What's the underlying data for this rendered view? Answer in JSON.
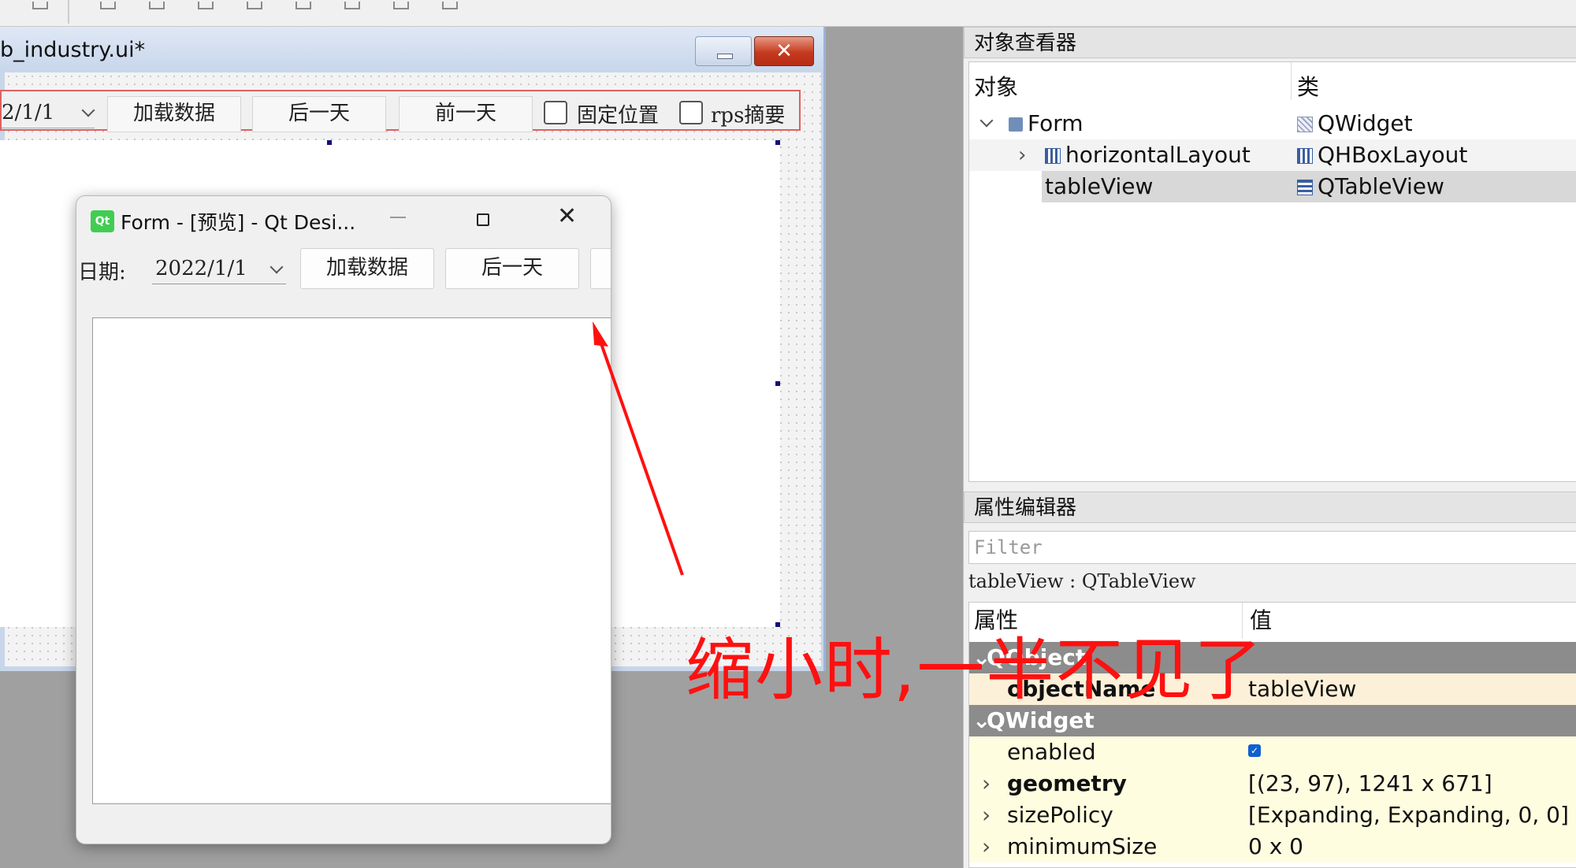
{
  "designer": {
    "title": "b_industry.ui*",
    "toolbar": {
      "date_value": "2/1/1",
      "load_button": "加载数据",
      "next_day_button": "后一天",
      "prev_day_button": "前一天",
      "fixed_position_label": "固定位置",
      "rps_summary_label": "rps摘要"
    }
  },
  "preview": {
    "title": "Form - [预览] - Qt Desi...",
    "date_label": "日期:",
    "date_value": "2022/1/1",
    "load_button": "加载数据",
    "next_day_button": "后一天"
  },
  "object_inspector": {
    "header": "对象查看器",
    "col_object": "对象",
    "col_class": "类",
    "rows": [
      {
        "name": "Form",
        "class": "QWidget"
      },
      {
        "name": "horizontalLayout",
        "class": "QHBoxLayout"
      },
      {
        "name": "tableView",
        "class": "QTableView"
      }
    ]
  },
  "property_editor": {
    "header": "属性编辑器",
    "filter_placeholder": "Filter",
    "class_line": "tableView : QTableView",
    "col_property": "属性",
    "col_value": "值",
    "groups": {
      "qobject": "QObject",
      "qwidget": "QWidget"
    },
    "props": {
      "object_name_label": "objectName",
      "object_name_value": "tableView",
      "enabled_label": "enabled",
      "geometry_label": "geometry",
      "geometry_value": "[(23, 97), 1241 x 671]",
      "size_policy_label": "sizePolicy",
      "size_policy_value": "[Expanding, Expanding, 0, 0]",
      "minimum_size_label": "minimumSize",
      "minimum_size_value": "0 x 0"
    }
  },
  "annotation": "缩小时,一半不见了",
  "colors": {
    "annotation": "#ff1010",
    "selected_row": "#d8d8d8",
    "group_row": "#8c8c8c",
    "property_row_highlight": "#fdf0d8",
    "property_row_yellow": "#fffde0"
  }
}
